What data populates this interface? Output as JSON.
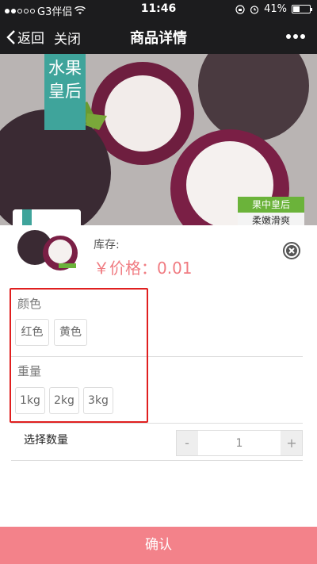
{
  "status_bar": {
    "carrier": "G3伴侣",
    "time": "11:46",
    "battery": "41%",
    "battery_level": 0.41
  },
  "nav": {
    "back_label": "返回",
    "close_label": "关闭",
    "title": "商品详情"
  },
  "hero": {
    "banner_text": "水果皇后",
    "tag_top": "果中皇后",
    "tag_bottom": "柔嫩滑爽"
  },
  "product": {
    "stock_label": "库存:",
    "price_label": "￥价格：0.01"
  },
  "options": {
    "color": {
      "label": "颜色",
      "choices": [
        "红色",
        "黄色"
      ]
    },
    "weight": {
      "label": "重量",
      "choices": [
        "1kg",
        "2kg",
        "3kg"
      ]
    }
  },
  "quantity": {
    "label": "选择数量",
    "minus": "-",
    "plus": "+",
    "value": "1"
  },
  "confirm_label": "确认",
  "colors": {
    "accent": "#f3828a",
    "price": "#f07c82",
    "highlight": "#e01f1f",
    "navbar": "#1c1c1e"
  },
  "icons": [
    "signal-dots-icon",
    "wifi-icon",
    "lock-rotation-icon",
    "alarm-icon",
    "battery-icon",
    "back-chevron-icon",
    "more-dots-icon",
    "close-circle-icon"
  ]
}
